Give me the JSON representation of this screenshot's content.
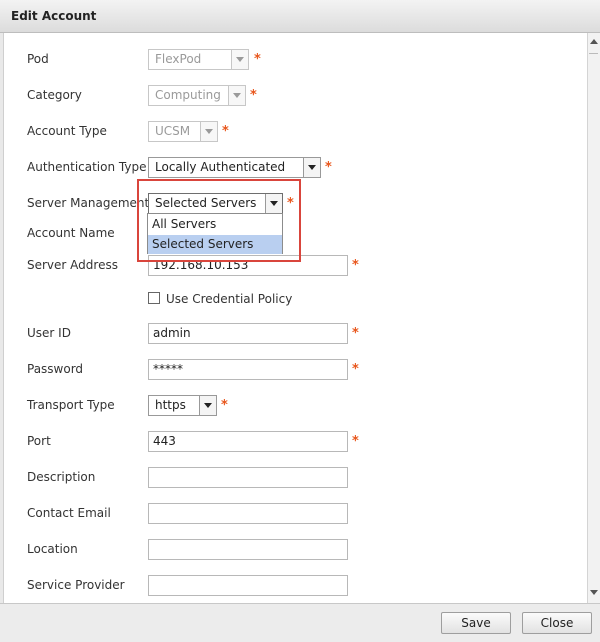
{
  "dialog": {
    "title": "Edit Account"
  },
  "fields": {
    "pod": {
      "label": "Pod",
      "value": "FlexPod"
    },
    "category": {
      "label": "Category",
      "value": "Computing"
    },
    "account_type": {
      "label": "Account Type",
      "value": "UCSM"
    },
    "authentication_type": {
      "label": "Authentication Type",
      "value": "Locally Authenticated"
    },
    "server_management": {
      "label": "Server Management",
      "value": "Selected Servers"
    },
    "account_name": {
      "label": "Account Name"
    },
    "server_address": {
      "label": "Server Address",
      "value": "192.168.10.153"
    },
    "use_credential_policy": {
      "label": "Use Credential Policy",
      "checked": false
    },
    "user_id": {
      "label": "User ID",
      "value": "admin"
    },
    "password": {
      "label": "Password",
      "value": "*****"
    },
    "transport_type": {
      "label": "Transport Type",
      "value": "https"
    },
    "port": {
      "label": "Port",
      "value": "443"
    },
    "description": {
      "label": "Description",
      "value": ""
    },
    "contact_email": {
      "label": "Contact Email",
      "value": ""
    },
    "location": {
      "label": "Location",
      "value": ""
    },
    "service_provider": {
      "label": "Service Provider",
      "value": ""
    }
  },
  "server_management_dropdown": {
    "options": [
      "All Servers",
      "Selected Servers"
    ],
    "selected": "Selected Servers"
  },
  "required_marker": "*",
  "footer": {
    "save_label": "Save",
    "close_label": "Close"
  },
  "colors": {
    "required": "#e8561c",
    "highlight_box": "#d9453c",
    "selected_option": "#b9cff0"
  }
}
